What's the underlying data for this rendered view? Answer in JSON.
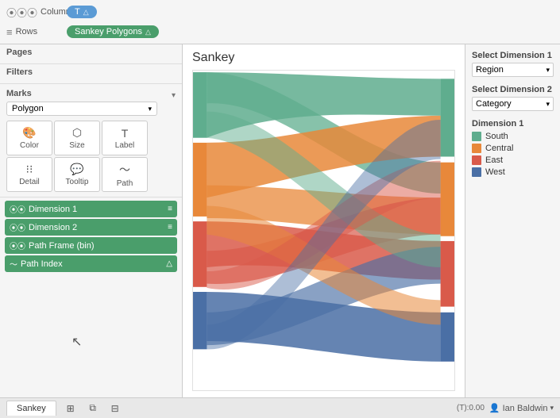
{
  "shelf": {
    "columns_label": "Columns",
    "rows_label": "Rows",
    "columns_pill": "T",
    "rows_pill": "Sankey Polygons"
  },
  "sidebar": {
    "pages_title": "Pages",
    "filters_title": "Filters",
    "marks_title": "Marks",
    "marks_type": "Polygon",
    "color_label": "Color",
    "size_label": "Size",
    "label_label": "Label",
    "detail_label": "Detail",
    "tooltip_label": "Tooltip",
    "path_label": "Path",
    "fields": [
      {
        "name": "Dimension 1",
        "type": "dim1"
      },
      {
        "name": "Dimension 2",
        "type": "dim2"
      },
      {
        "name": "Path Frame (bin)",
        "type": "path-frame"
      },
      {
        "name": "Path Index",
        "type": "path-index"
      }
    ]
  },
  "chart": {
    "title": "Sankey"
  },
  "right_panel": {
    "select_dim1_label": "Select Dimension 1",
    "dim1_value": "Region",
    "select_dim2_label": "Select Dimension 2",
    "dim2_value": "Category",
    "legend_title": "Dimension 1",
    "legend_items": [
      {
        "label": "South",
        "color": "#5fad8e"
      },
      {
        "label": "Central",
        "color": "#e8883a"
      },
      {
        "label": "East",
        "color": "#d95a4a"
      },
      {
        "label": "West",
        "color": "#4a6fa5"
      }
    ]
  },
  "status_bar": {
    "tab_label": "Sankey",
    "coords": "(T):0.00",
    "user_name": "Ian Baldwin"
  }
}
